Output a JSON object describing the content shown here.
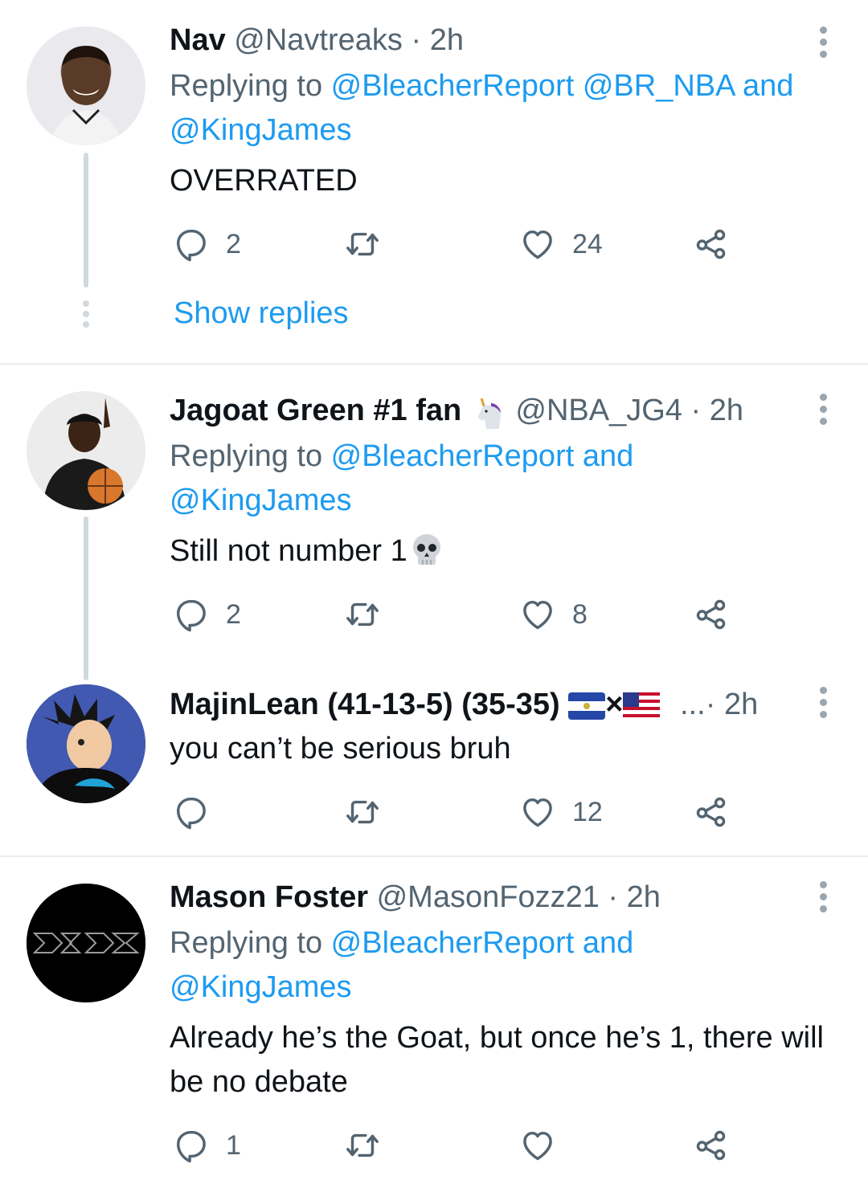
{
  "tweets": [
    {
      "name": "Nav",
      "handle": "@Navtreaks",
      "time": "2h",
      "replying_prefix": "Replying to ",
      "replying_links": [
        "@BleacherReport",
        "@BR_NBA",
        "@KingJames"
      ],
      "replying_joiner": "and",
      "text": "OVERRATED",
      "replies": "2",
      "likes": "24",
      "show_replies": "Show replies"
    },
    {
      "name": "Jagoat Green #1 fan",
      "name_emoji": "unicorn-icon",
      "handle": "@NBA_JG4",
      "time": "2h",
      "replying_prefix": "Replying to ",
      "replying_links": [
        "@BleacherReport",
        "@KingJames"
      ],
      "replying_joiner": "and",
      "text": "Still not number 1",
      "text_emoji": "skull-icon",
      "replies": "2",
      "likes": "8"
    },
    {
      "name": "MajinLean (41-13-5) (35-35)",
      "flags": [
        "el-salvador-flag-icon",
        "usa-flag-icon"
      ],
      "flag_joiner": "×",
      "handle_truncated": "...",
      "time": "2h",
      "text": "you can’t be serious bruh",
      "likes": "12"
    },
    {
      "name": "Mason Foster",
      "handle": "@MasonFozz21",
      "time": "2h",
      "replying_prefix": "Replying to ",
      "replying_links": [
        "@BleacherReport",
        "@KingJames"
      ],
      "replying_joiner": "and",
      "text": "Already he’s the Goat, but once he’s 1, there will be no debate",
      "replies": "1"
    }
  ],
  "separator": "·",
  "colors": {
    "link": "#1d9bf0",
    "secondary": "#536471",
    "text": "#0f1419",
    "divider": "#e6ecf0"
  }
}
